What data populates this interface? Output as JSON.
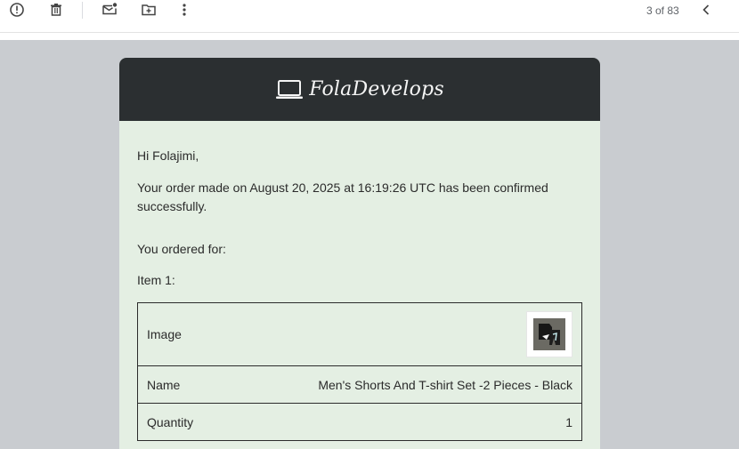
{
  "toolbar": {
    "icons": [
      "report-spam-icon",
      "delete-icon",
      "mark-unread-icon",
      "move-to-icon",
      "more-vert-icon",
      "chevron-left-icon"
    ],
    "pager_text": "3 of 83"
  },
  "email": {
    "brand": {
      "icon": "laptop-icon",
      "name": "FolaDevelops"
    },
    "greeting": "Hi Folajimi,",
    "confirmation": "Your order made on August 20, 2025 at 16:19:26 UTC has been confirmed successfully.",
    "ordered_for": "You ordered for:",
    "item_label": "Item 1:",
    "item_table": [
      {
        "label": "Image",
        "value": ""
      },
      {
        "label": "Name",
        "value": "Men's Shorts And T-shirt Set -2 Pieces - Black"
      },
      {
        "label": "Quantity",
        "value": "1"
      }
    ]
  },
  "colors": {
    "header_bg": "#2b2f31",
    "body_bg": "#e4efe3",
    "page_bg": "#c9ccd0"
  }
}
